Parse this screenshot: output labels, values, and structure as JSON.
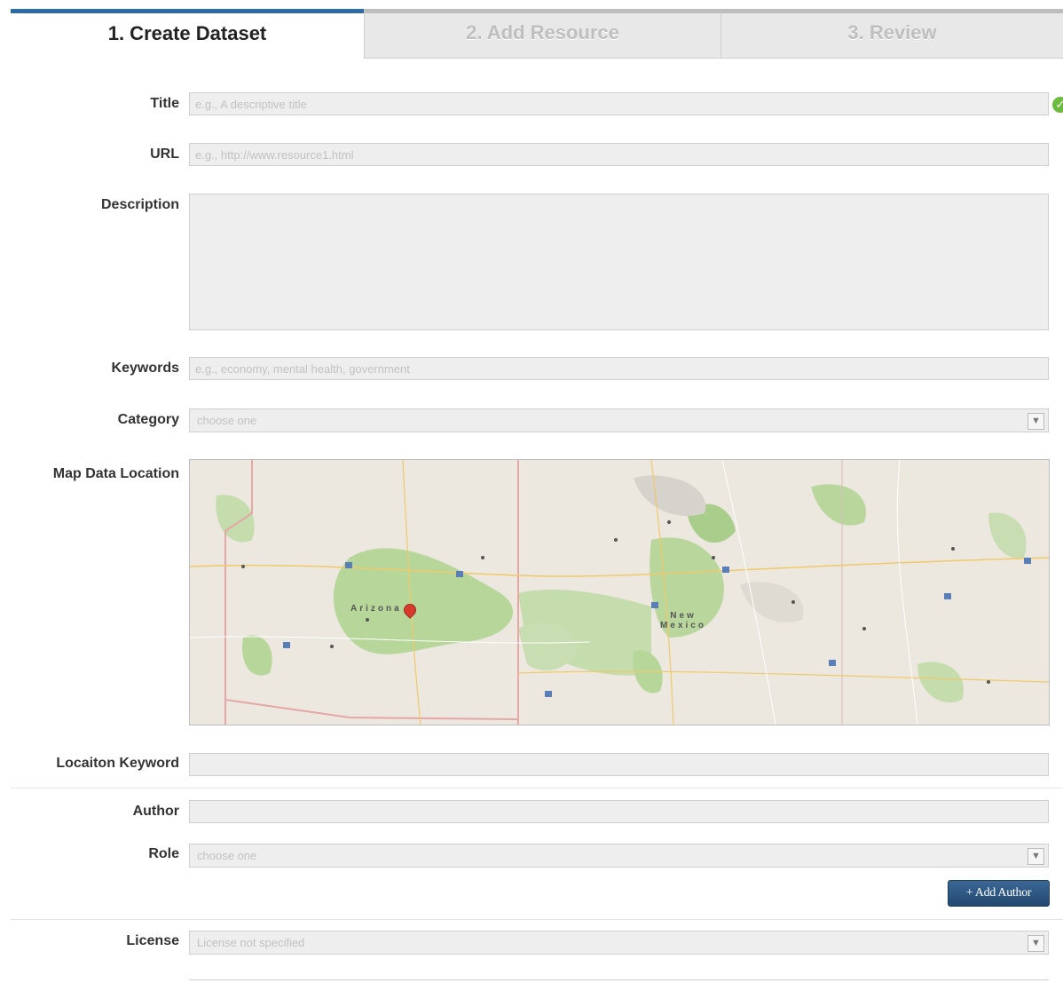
{
  "wizard": {
    "tabs": [
      {
        "label": "1. Create Dataset",
        "active": true
      },
      {
        "label": "2. Add Resource",
        "active": false
      },
      {
        "label": "3. Review",
        "active": false
      }
    ]
  },
  "form": {
    "title": {
      "label": "Title",
      "placeholder": "e.g., A descriptive title"
    },
    "url": {
      "label": "URL",
      "placeholder": "e.g., http://www.resource1.html"
    },
    "description": {
      "label": "Description",
      "placeholder": ""
    },
    "keywords": {
      "label": "Keywords",
      "placeholder": "e.g., economy, mental health, government"
    },
    "category": {
      "label": "Category",
      "selected": "choose one"
    },
    "map": {
      "label": "Map Data Location",
      "regions": [
        "Arizona",
        "New Mexico"
      ]
    },
    "location_keyword": {
      "label": "Locaiton Keyword",
      "placeholder": ""
    },
    "author": {
      "label": "Author",
      "placeholder": ""
    },
    "role": {
      "label": "Role",
      "selected": "choose one"
    },
    "add_author_button": "+ Add Author",
    "license": {
      "label": "License",
      "selected": "License not specified"
    }
  },
  "icons": {
    "valid": "check-circle-icon",
    "dropdown": "triangle-down-icon"
  },
  "colors": {
    "accent": "#2e6aa3",
    "button": "#2b5179",
    "valid": "#6dbb3f"
  }
}
